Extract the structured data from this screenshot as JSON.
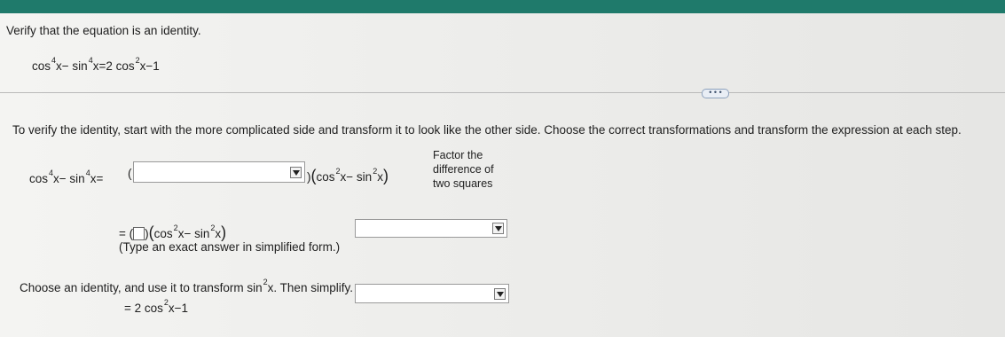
{
  "header": {
    "instruction": "Verify that the equation is an identity.",
    "equation": {
      "a": "cos",
      "e1": "4",
      "b": "x−  sin",
      "e2": "4",
      "c": "x=2  cos",
      "e3": "2",
      "d": "x−1"
    }
  },
  "more_button": "• • •",
  "main": {
    "intro": "To verify the identity, start with the more complicated side and transform it to look like the other side. Choose the correct transformations and transform the expression at each step.",
    "step1": {
      "lhs": {
        "a": "cos",
        "e1": "4",
        "b": "x−  sin",
        "e2": "4",
        "c": "x="
      },
      "open_paren": "(",
      "close_paren": ")",
      "factor": {
        "a": "cos",
        "e1": "2",
        "b": "x−  sin",
        "e2": "2",
        "c": "x"
      },
      "note": [
        "Factor the",
        "difference of",
        "two squares"
      ]
    },
    "step2": {
      "eq": "=",
      "open_paren": "(",
      "close_paren": ")",
      "factor": {
        "a": "cos",
        "e1": "2",
        "b": "x−  sin",
        "e2": "2",
        "c": "x"
      },
      "hint": "(Type an exact answer in simplified form.)"
    },
    "step3": {
      "instruction_pre": "Choose an identity, and use it to transform ",
      "sin": "sin",
      "e": "2",
      "instruction_post": "x. Then simplify.",
      "result": {
        "a": "= 2  cos",
        "e": "2",
        "b": "x−1"
      }
    }
  }
}
